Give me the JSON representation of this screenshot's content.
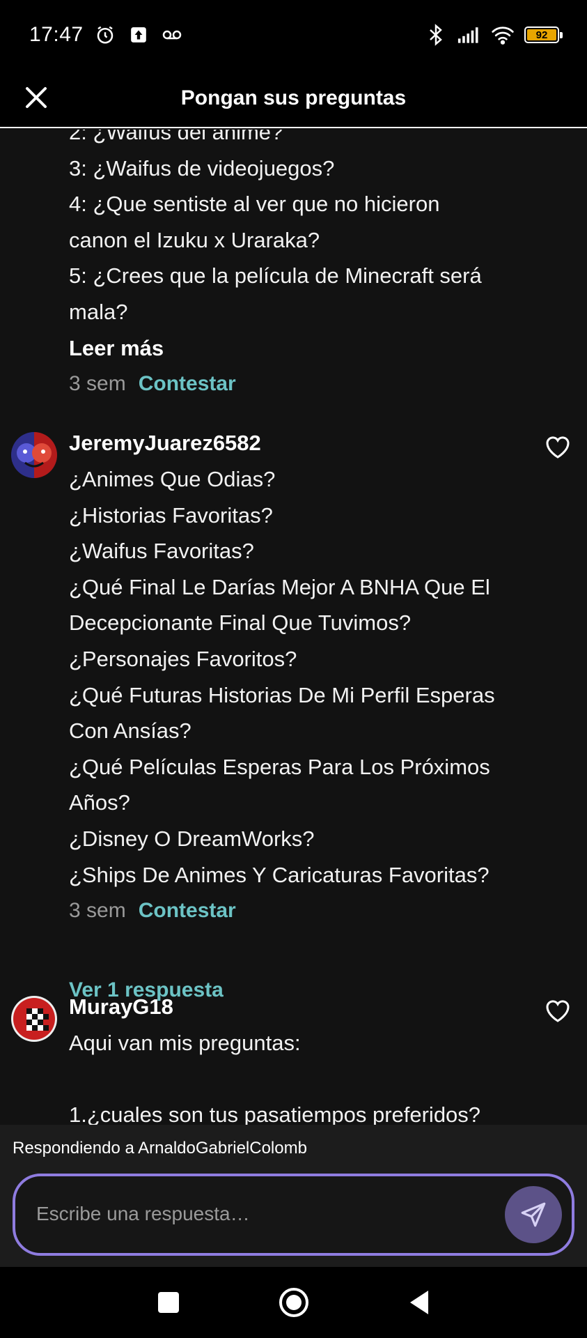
{
  "status_bar": {
    "time": "17:47",
    "battery_level": "92",
    "icons": [
      "alarm-icon",
      "upload-icon",
      "voicemail-icon",
      "bluetooth-icon",
      "signal-icon",
      "wifi-icon",
      "battery-icon"
    ]
  },
  "header": {
    "title": "Pongan sus preguntas",
    "close_icon": "close-icon"
  },
  "first_comment_tail": {
    "lines": [
      "2: ¿Waifus del anime?",
      "3: ¿Waifus de videojuegos?",
      "4: ¿Que sentiste al ver que no hicieron",
      "canon el Izuku x Uraraka?",
      "5: ¿Crees que la película de Minecraft será",
      "mala?"
    ],
    "read_more": "Leer más",
    "time": "3 sem",
    "reply_label": "Contestar"
  },
  "comments": [
    {
      "username": "JeremyJuarez6582",
      "lines": [
        "¿Animes Que Odias?",
        "¿Historias Favoritas?",
        "¿Waifus Favoritas?",
        "¿Qué Final Le Darías Mejor A BNHA Que El",
        "Decepcionante Final Que Tuvimos?",
        "¿Personajes Favoritos?",
        "¿Qué Futuras Historias De Mi Perfil Esperas",
        "Con Ansías?",
        "¿Qué Películas Esperas Para Los Próximos",
        "Años?",
        "¿Disney O DreamWorks?",
        "¿Ships De Animes Y Caricaturas Favoritas?"
      ],
      "time": "3 sem",
      "reply_label": "Contestar",
      "view_replies": "Ver 1 respuesta"
    },
    {
      "username": "MurayG18",
      "lines": [
        "Aqui van mis preguntas:",
        "",
        "1.¿cuales son tus pasatiempos preferidos?"
      ]
    }
  ],
  "composer": {
    "replying_to": "Respondiendo a ArnaldoGabrielColomb",
    "placeholder": "Escribe una respuesta…",
    "accent_color": "#8f7ce0"
  },
  "colors": {
    "background": "#121212",
    "link": "#6cc3c5",
    "muted": "#9a9a9a"
  }
}
